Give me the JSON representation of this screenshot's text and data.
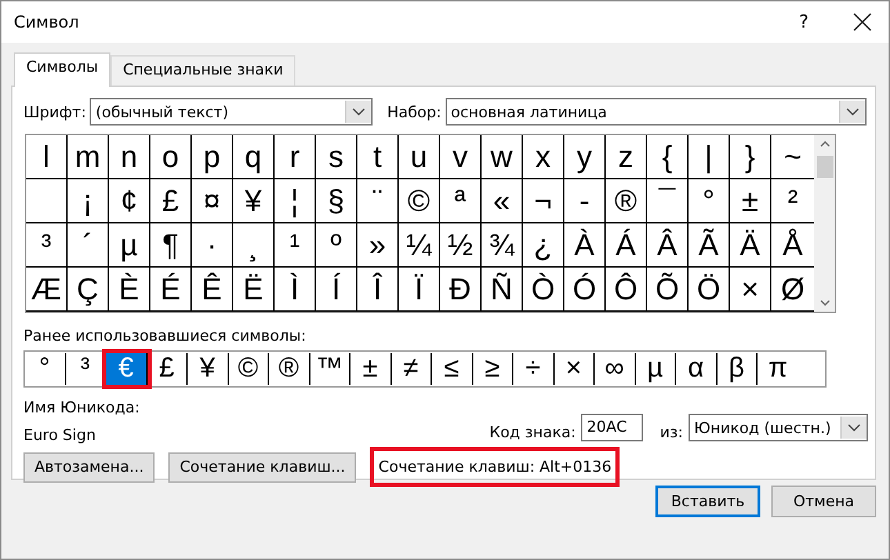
{
  "window": {
    "title": "Символ",
    "help": "?"
  },
  "tabs": [
    {
      "label": "Символы",
      "selected": true
    },
    {
      "label": "Специальные знаки",
      "selected": false
    }
  ],
  "font": {
    "label": "Шрифт:",
    "value": "(обычный текст)"
  },
  "subset": {
    "label": "Набор:",
    "value": "основная латиница"
  },
  "grid": {
    "rows": [
      [
        "l",
        "m",
        "n",
        "o",
        "p",
        "q",
        "r",
        "s",
        "t",
        "u",
        "v",
        "w",
        "x",
        "y",
        "z",
        "{",
        "|",
        "}",
        "~"
      ],
      [
        " ",
        "¡",
        "¢",
        "£",
        "¤",
        "¥",
        "¦",
        "§",
        "¨",
        "©",
        "ª",
        "«",
        "¬",
        "-",
        "®",
        "¯",
        "°",
        "±",
        "²"
      ],
      [
        "³",
        "´",
        "µ",
        "¶",
        "·",
        "¸",
        "¹",
        "º",
        "»",
        "¼",
        "½",
        "¾",
        "¿",
        "À",
        "Á",
        "Â",
        "Ã",
        "Ä",
        "Å"
      ],
      [
        "Æ",
        "Ç",
        "È",
        "É",
        "Ê",
        "Ë",
        "Ì",
        "Í",
        "Î",
        "Ï",
        "Ð",
        "Ñ",
        "Ò",
        "Ó",
        "Ô",
        "Õ",
        "Ö",
        "×",
        "Ø"
      ]
    ]
  },
  "recent": {
    "label": "Ранее использовавшиеся символы:",
    "items": [
      {
        "char": "°",
        "selected": false,
        "highlighted": false
      },
      {
        "char": "³",
        "selected": false,
        "highlighted": false
      },
      {
        "char": "€",
        "selected": true,
        "highlighted": true
      },
      {
        "char": "£",
        "selected": false,
        "highlighted": false
      },
      {
        "char": "¥",
        "selected": false,
        "highlighted": false
      },
      {
        "char": "©",
        "selected": false,
        "highlighted": false
      },
      {
        "char": "®",
        "selected": false,
        "highlighted": false
      },
      {
        "char": "™",
        "selected": false,
        "highlighted": false
      },
      {
        "char": "±",
        "selected": false,
        "highlighted": false
      },
      {
        "char": "≠",
        "selected": false,
        "highlighted": false
      },
      {
        "char": "≤",
        "selected": false,
        "highlighted": false
      },
      {
        "char": "≥",
        "selected": false,
        "highlighted": false
      },
      {
        "char": "÷",
        "selected": false,
        "highlighted": false
      },
      {
        "char": "×",
        "selected": false,
        "highlighted": false
      },
      {
        "char": "∞",
        "selected": false,
        "highlighted": false
      },
      {
        "char": "µ",
        "selected": false,
        "highlighted": false
      },
      {
        "char": "α",
        "selected": false,
        "highlighted": false
      },
      {
        "char": "β",
        "selected": false,
        "highlighted": false
      },
      {
        "char": "π",
        "selected": false,
        "highlighted": false
      }
    ]
  },
  "unicode_name": {
    "label": "Имя Юникода:",
    "value": "Euro Sign"
  },
  "char_code": {
    "label": "Код знака:",
    "value": "20AC"
  },
  "from": {
    "label": "из:",
    "value": "Юникод (шестн.)"
  },
  "buttons": [
    "Автозамена...",
    "Сочетание клавиш..."
  ],
  "shortcut": {
    "text": "Сочетание клавиш: Alt+0136",
    "highlighted": true
  },
  "footer_buttons": [
    {
      "label": "Вставить",
      "default": true
    },
    {
      "label": "Отмена",
      "default": false
    }
  ]
}
